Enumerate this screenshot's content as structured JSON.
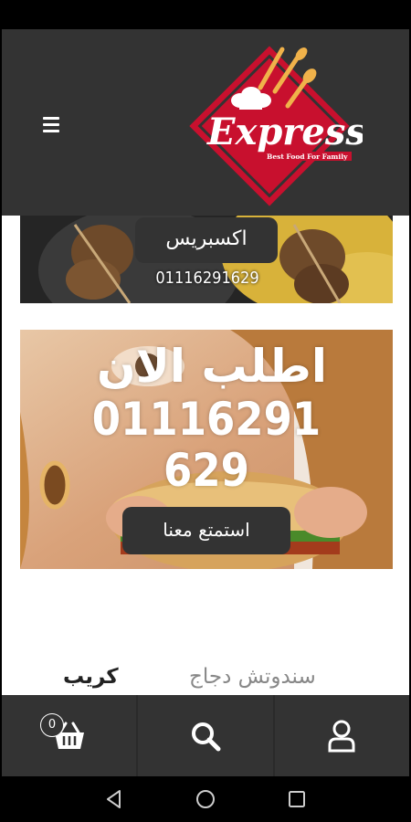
{
  "header": {
    "logo_text": "Express",
    "logo_tagline": "Best Food For Family"
  },
  "banner1": {
    "title": "اكسبريس",
    "phone": "01116291629"
  },
  "banner2": {
    "headline": "اطلب الان",
    "phone": "01116291629",
    "button_label": "استمتع معنا"
  },
  "tabs": [
    {
      "label": "سندوتش دجاج",
      "active": false
    },
    {
      "label": "كريب",
      "active": true
    }
  ],
  "bottom_nav": {
    "cart_count": "0",
    "items": [
      "cart",
      "search",
      "account"
    ]
  },
  "colors": {
    "header_bg": "#333333",
    "brand_red": "#c8102e",
    "button_bg": "#333333"
  }
}
